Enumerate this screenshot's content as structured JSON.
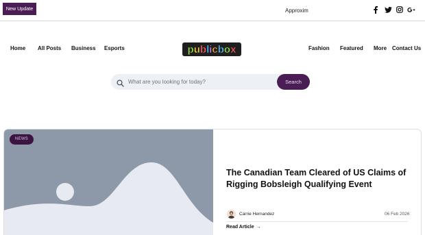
{
  "topbar": {
    "badge_label": "New Update",
    "ticker_text": "Approxim",
    "social_icons": [
      "facebook-icon",
      "twitter-icon",
      "instagram-icon",
      "google-plus-icon"
    ]
  },
  "nav": {
    "left": [
      "Home",
      "All Posts",
      "Business",
      "Esports"
    ],
    "right": [
      "Fashion",
      "Featured",
      "More",
      "Contact Us"
    ]
  },
  "logo": {
    "text": "publicbox"
  },
  "search": {
    "placeholder": "What are you looking for today?",
    "value": "",
    "button_label": "Search"
  },
  "featured_post": {
    "category": "NEWS",
    "title": "The Canadian Team Cleared of US Claims of Rigging Bobsleigh Qualifying Event",
    "author": "Carrie Hernandez",
    "date": "06 Feb 2026",
    "read_more": "Read Article",
    "read_more_arrow": "→"
  },
  "colors": {
    "brand_purple": "#4b1d55",
    "image_placeholder": "#8d99a8",
    "search_bg": "#edf1f6"
  }
}
